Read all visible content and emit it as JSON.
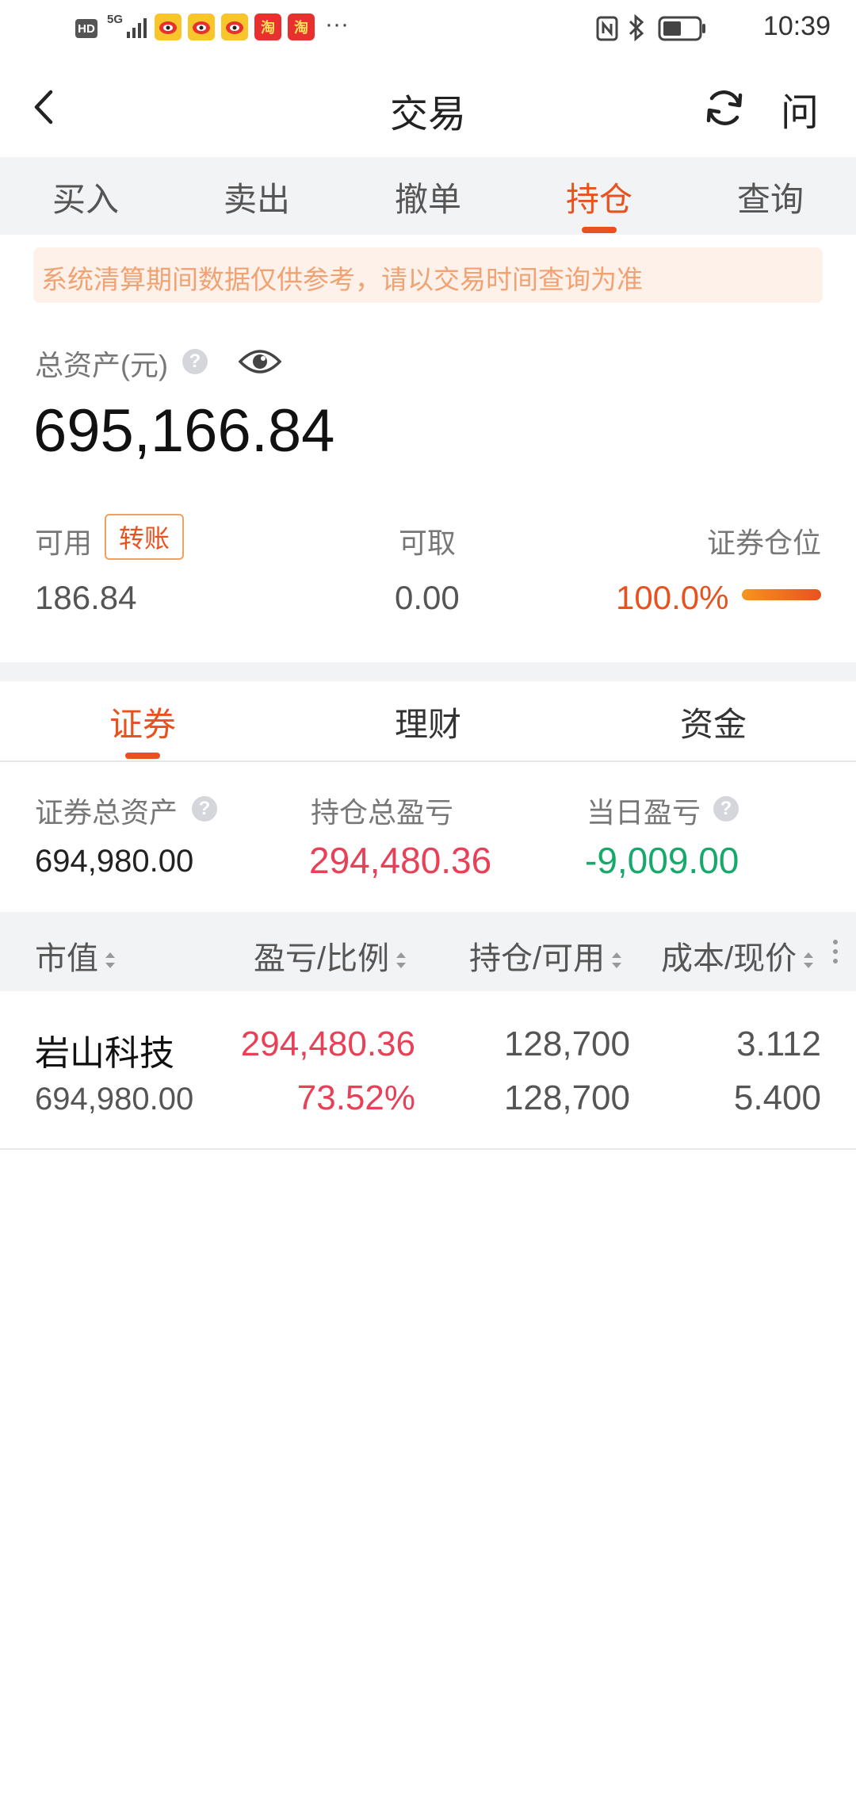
{
  "status_bar": {
    "network_hd": "HD",
    "network_5g": "5G",
    "app_icon_taobao": "淘",
    "more": "···",
    "time": "10:39"
  },
  "nav": {
    "title": "交易",
    "ask_label": "问"
  },
  "tabs": [
    {
      "label": "买入"
    },
    {
      "label": "卖出"
    },
    {
      "label": "撤单"
    },
    {
      "label": "持仓",
      "active": true
    },
    {
      "label": "查询"
    }
  ],
  "notice": "系统清算期间数据仅供参考，请以交易时间查询为准",
  "assets": {
    "total_label": "总资产(元)",
    "total_value": "695,166.84",
    "available_label": "可用",
    "transfer_label": "转账",
    "available_value": "186.84",
    "withdrawable_label": "可取",
    "withdrawable_value": "0.00",
    "position_label": "证券仓位",
    "position_value": "100.0%",
    "position_ratio": 1.0
  },
  "sub_tabs": [
    {
      "label": "证券",
      "active": true
    },
    {
      "label": "理财"
    },
    {
      "label": "资金"
    }
  ],
  "summary": {
    "sec_total_label": "证券总资产",
    "sec_total_value": "694,980.00",
    "hold_pnl_label": "持仓总盈亏",
    "hold_pnl_value": "294,480.36",
    "day_pnl_label": "当日盈亏",
    "day_pnl_value": "-9,009.00"
  },
  "table": {
    "headers": [
      "市值",
      "盈亏/比例",
      "持仓/可用",
      "成本/现价"
    ],
    "rows": [
      {
        "name": "岩山科技",
        "market_value": "694,980.00",
        "pnl": "294,480.36",
        "pnl_ratio": "73.52%",
        "position": "128,700",
        "available": "128,700",
        "cost": "3.112",
        "price": "5.400"
      }
    ]
  },
  "colors": {
    "accent": "#e8521f",
    "profit": "#e84057",
    "loss": "#17a86b",
    "background_gray": "#f2f3f5"
  },
  "icons": [
    "back-arrow-icon",
    "refresh-icon",
    "eye-icon",
    "help-icon",
    "sort-icon",
    "more-vertical-icon",
    "nfc-icon",
    "bluetooth-icon",
    "battery-icon",
    "weibo-icon",
    "taobao-icon"
  ]
}
